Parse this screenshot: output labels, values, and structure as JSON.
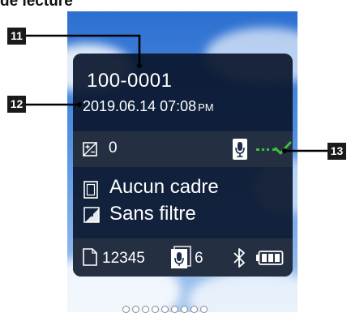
{
  "heading": "de lecture",
  "file_number": "100-0001",
  "datetime": {
    "date_time": "2019.06.14  07:08",
    "ampm": "PM"
  },
  "exposure": {
    "icon": "exposure-compensation-icon",
    "value": "0"
  },
  "voice_memo": {
    "icon": "voice-memo-icon",
    "status_icon": "check-icon",
    "status_color": "#3fbf3f"
  },
  "frame": {
    "icon": "frame-icon",
    "label": "Aucun cadre"
  },
  "filter": {
    "icon": "filter-icon",
    "label": "Sans filtre"
  },
  "status_bar": {
    "image_count": "12345",
    "memo_count": "6",
    "bluetooth_icon": "bluetooth-icon",
    "battery_icon": "battery-icon"
  },
  "callouts": {
    "c11": "11",
    "c12": "12",
    "c13": "13"
  },
  "page_dot_count": 9
}
